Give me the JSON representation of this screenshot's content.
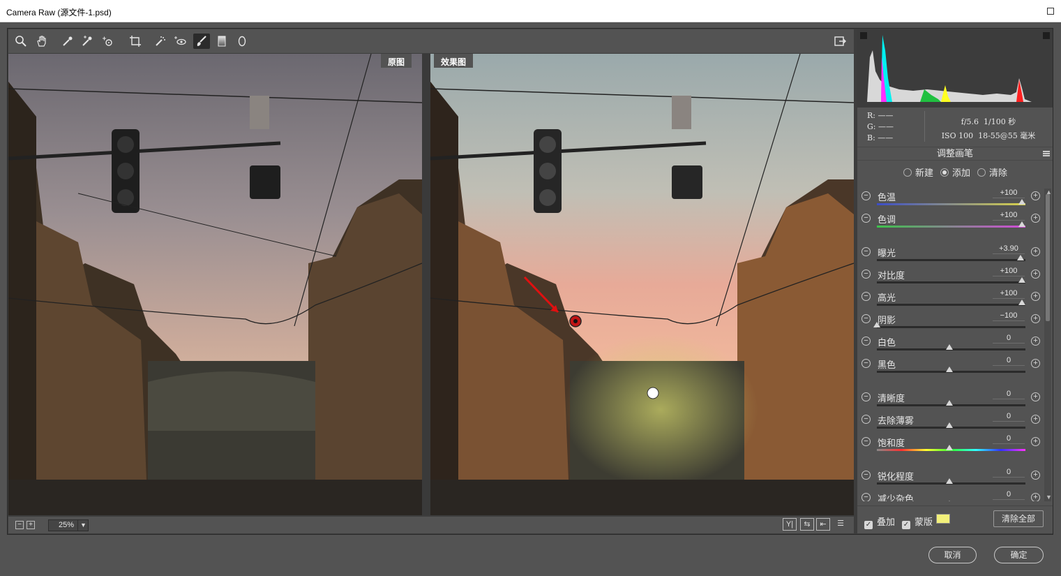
{
  "window": {
    "title": "Camera Raw (源文件-1.psd)"
  },
  "toolbar": {
    "tools": [
      "zoom-tool",
      "hand-tool",
      "white-balance-tool",
      "color-sampler-tool",
      "targeted-adjustment-tool",
      "crop-tool",
      "spot-removal-tool",
      "red-eye-tool",
      "adjustment-brush-tool",
      "graduated-filter-tool",
      "radial-filter-tool"
    ],
    "active_tool": "adjustment-brush-tool",
    "export_icon": "open-preferences-icon"
  },
  "preview": {
    "before_label": "原图",
    "after_label": "效果图"
  },
  "bottom": {
    "zoom": "25%"
  },
  "histogram": {
    "channels": [
      "red",
      "green",
      "blue",
      "cyan",
      "magenta",
      "yellow"
    ]
  },
  "info": {
    "r_label": "R:",
    "g_label": "G:",
    "b_label": "B:",
    "r": "——",
    "g": "——",
    "b": "——",
    "aperture": "f/5.6",
    "shutter": "1/100 秒",
    "iso": "ISO 100",
    "lens": "18-55@55 毫米"
  },
  "panel": {
    "title": "调整画笔",
    "modes": [
      {
        "label": "新建",
        "selected": false
      },
      {
        "label": "添加",
        "selected": true
      },
      {
        "label": "清除",
        "selected": false
      }
    ],
    "sliders": [
      {
        "label": "色温",
        "value": "+100",
        "pos": 1.0,
        "track": "temp"
      },
      {
        "label": "色调",
        "value": "+100",
        "pos": 1.0,
        "track": "tint"
      },
      {
        "label": "曝光",
        "value": "+3.90",
        "pos": 0.99,
        "track": "gray"
      },
      {
        "label": "对比度",
        "value": "+100",
        "pos": 1.0,
        "track": "gray"
      },
      {
        "label": "高光",
        "value": "+100",
        "pos": 1.0,
        "track": "gray"
      },
      {
        "label": "阴影",
        "value": "−100",
        "pos": 0.0,
        "track": "gray"
      },
      {
        "label": "白色",
        "value": "0",
        "pos": 0.5,
        "track": "gray"
      },
      {
        "label": "黑色",
        "value": "0",
        "pos": 0.5,
        "track": "gray"
      },
      {
        "label": "清晰度",
        "value": "0",
        "pos": 0.5,
        "track": "gray"
      },
      {
        "label": "去除薄雾",
        "value": "0",
        "pos": 0.5,
        "track": "gray"
      },
      {
        "label": "饱和度",
        "value": "0",
        "pos": 0.5,
        "track": "sat"
      },
      {
        "label": "锐化程度",
        "value": "0",
        "pos": 0.5,
        "track": "gray"
      },
      {
        "label": "减少杂色",
        "value": "0",
        "pos": 0.5,
        "track": "gray"
      }
    ],
    "overlay_label": "叠加",
    "mask_label": "蒙版",
    "mask_color": "#f2f07a",
    "clear_all": "清除全部"
  },
  "dialog": {
    "cancel": "取消",
    "ok": "确定"
  }
}
